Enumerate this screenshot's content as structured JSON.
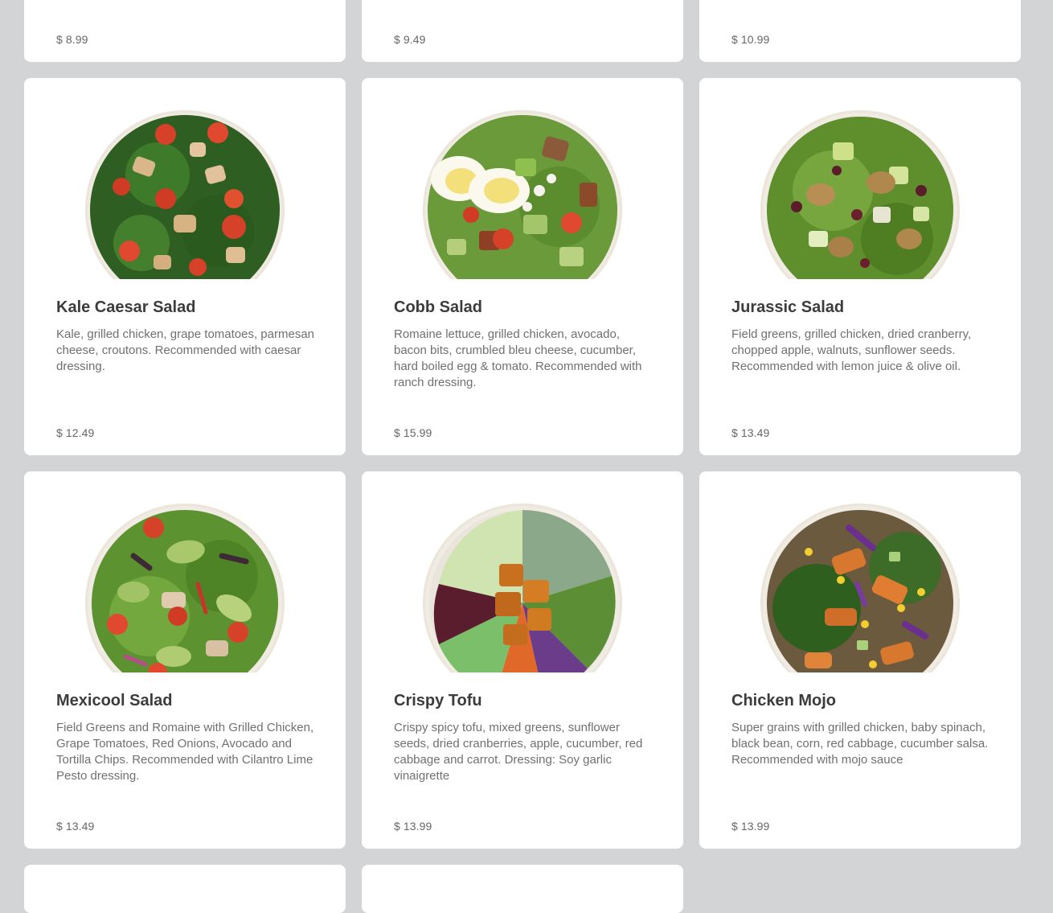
{
  "top_row_prices": [
    "$ 8.99",
    "$ 9.49",
    "$ 10.99"
  ],
  "items": [
    {
      "name": "Kale Caesar Salad",
      "description": "Kale, grilled chicken, grape tomatoes, parmesan cheese, croutons. Recommended with caesar dressing.",
      "price": "$ 12.49",
      "image_icon": "kale-caesar-salad-bowl"
    },
    {
      "name": "Cobb Salad",
      "description": "Romaine lettuce, grilled chicken, avocado, bacon bits, crumbled bleu cheese, cucumber, hard boiled egg & tomato. Recommended with ranch dressing.",
      "price": "$ 15.99",
      "image_icon": "cobb-salad-bowl"
    },
    {
      "name": "Jurassic Salad",
      "description": "Field greens, grilled chicken, dried cranberry, chopped apple, walnuts, sunflower seeds. Recommended with lemon juice & olive oil.",
      "price": "$ 13.49",
      "image_icon": "jurassic-salad-bowl"
    },
    {
      "name": "Mexicool Salad",
      "description": "Field Greens and Romaine with Grilled Chicken, Grape Tomatoes, Red Onions, Avocado and Tortilla Chips. Recommended with Cilantro Lime Pesto dressing.",
      "price": "$ 13.49",
      "image_icon": "mexicool-salad-bowl"
    },
    {
      "name": "Crispy Tofu",
      "description": "Crispy spicy tofu, mixed greens, sunflower seeds, dried cranberries, apple, cucumber, red cabbage and carrot. Dressing: Soy garlic vinaigrette",
      "price": "$ 13.99",
      "image_icon": "crispy-tofu-bowl"
    },
    {
      "name": "Chicken Mojo",
      "description": "Super grains with grilled chicken, baby spinach, black bean, corn, red cabbage, cucumber salsa. Recommended with mojo sauce",
      "price": "$ 13.99",
      "image_icon": "chicken-mojo-bowl"
    }
  ],
  "colors": {
    "background": "#d3d4d6",
    "card": "#ffffff",
    "title": "#3c3c3c",
    "text": "#707070"
  }
}
